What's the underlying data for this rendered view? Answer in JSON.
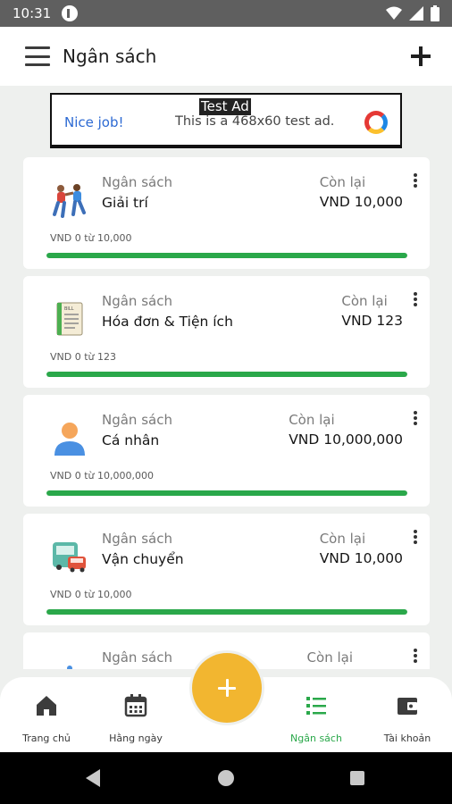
{
  "status_bar": {
    "time": "10:31",
    "icons": [
      "app-notification-icon",
      "wifi-icon",
      "cell-signal-icon",
      "battery-icon"
    ]
  },
  "app_bar": {
    "title": "Ngân sách",
    "icons": [
      "menu-icon",
      "add-icon"
    ]
  },
  "ad": {
    "label": "Test Ad",
    "headline": "Nice job!",
    "text": "This is a 468x60 test ad."
  },
  "budgets": [
    {
      "label": "Ngân sách",
      "name": "Giải trí",
      "remaining_label": "Còn lại",
      "remaining": "VND 10,000",
      "progress_text": "VND 0 từ 10,000",
      "fill": 1.0,
      "icon": "entertainment-icon"
    },
    {
      "label": "Ngân sách",
      "name": "Hóa đơn & Tiện ích",
      "remaining_label": "Còn lại",
      "remaining": "VND 123",
      "progress_text": "VND 0 từ 123",
      "fill": 1.0,
      "icon": "bill-icon"
    },
    {
      "label": "Ngân sách",
      "name": "Cá nhân",
      "remaining_label": "Còn lại",
      "remaining": "VND 10,000,000",
      "progress_text": "VND 0 từ 10,000,000",
      "fill": 1.0,
      "icon": "person-icon"
    },
    {
      "label": "Ngân sách",
      "name": "Vận chuyển",
      "remaining_label": "Còn lại",
      "remaining": "VND 10,000",
      "progress_text": "VND 0 từ 10,000",
      "fill": 1.0,
      "icon": "transport-icon"
    },
    {
      "label": "Ngân sách",
      "name": "",
      "remaining_label": "Còn lại",
      "remaining": "",
      "progress_text": "",
      "fill": 1.0,
      "icon": "category-icon"
    }
  ],
  "bottom_nav": [
    {
      "label": "Trang chủ",
      "icon": "home-icon"
    },
    {
      "label": "Hằng ngày",
      "icon": "calendar-icon"
    },
    {
      "label": "Ngân sách",
      "icon": "list-icon"
    },
    {
      "label": "Tài khoản",
      "icon": "wallet-icon"
    }
  ],
  "colors": {
    "accent": "#2aa84a",
    "fab": "#f2b630",
    "status_bar": "#5f5f5f"
  }
}
